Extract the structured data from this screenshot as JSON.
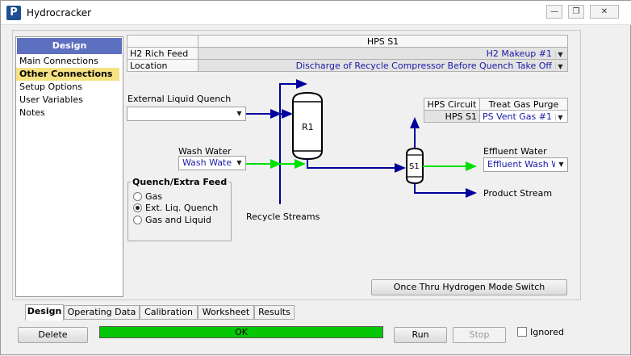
{
  "window": {
    "title": "Hydrocracker",
    "app_icon": "P"
  },
  "nav": {
    "header": "Design",
    "items": [
      "Main Connections",
      "Other Connections",
      "Setup Options",
      "User Variables",
      "Notes"
    ],
    "selected": "Other Connections"
  },
  "top_grid": {
    "header": "HPS S1",
    "rows": [
      {
        "label": "H2 Rich Feed",
        "value": "H2 Makeup #1"
      },
      {
        "label": "Location",
        "value": "Discharge of Recycle Compressor Before Quench Take Off"
      }
    ]
  },
  "ext_quench": {
    "label": "External Liquid Quench",
    "value": ""
  },
  "wash_water": {
    "label": "Wash Water",
    "value": "Wash Wate"
  },
  "quench_group": {
    "title": "Quench/Extra Feed",
    "options": [
      "Gas",
      "Ext. Liq. Quench",
      "Gas and Liquid"
    ],
    "selected": "Ext. Liq. Quench"
  },
  "diagram": {
    "reactor_label": "R1",
    "separator_label": "S1",
    "recycle_label": "Recycle Streams",
    "effluent_water_label": "Effluent Water",
    "effluent_water_value": "Effluent Wash W",
    "product_label": "Product Stream"
  },
  "hps_grid": {
    "col1": "HPS Circuit",
    "col2": "Treat Gas Purge",
    "row_label": "HPS S1",
    "row_value": "PS Vent Gas #1"
  },
  "buttons": {
    "once_thru": "Once Thru Hydrogen Mode Switch",
    "delete": "Delete",
    "run": "Run",
    "stop": "Stop"
  },
  "tabs": [
    "Design",
    "Operating Data",
    "Calibration",
    "Worksheet",
    "Results"
  ],
  "selected_tab": "Design",
  "status": {
    "text": "OK",
    "color": "#06c706"
  },
  "ignored": {
    "label": "Ignored",
    "checked": false
  },
  "colors": {
    "stream_blue": "#00009c",
    "water_green": "#00e000",
    "nav_header": "#5d6fbf",
    "selected_item": "#f7e282"
  }
}
